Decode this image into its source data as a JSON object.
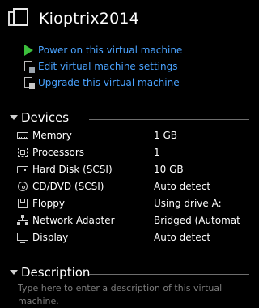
{
  "vm": {
    "name": "Kioptrix2014"
  },
  "actions": [
    {
      "label": "Power on this virtual machine",
      "icon": "power-on-icon"
    },
    {
      "label": "Edit virtual machine settings",
      "icon": "edit-settings-icon"
    },
    {
      "label": "Upgrade this virtual machine",
      "icon": "upgrade-icon"
    }
  ],
  "devices": {
    "title": "Devices",
    "rows": [
      {
        "name": "Memory",
        "value": "1 GB",
        "icon": "memory-icon"
      },
      {
        "name": "Processors",
        "value": "1",
        "icon": "processor-icon"
      },
      {
        "name": "Hard Disk (SCSI)",
        "value": "10 GB",
        "icon": "hard-disk-icon"
      },
      {
        "name": "CD/DVD (SCSI)",
        "value": "Auto detect",
        "icon": "cd-dvd-icon"
      },
      {
        "name": "Floppy",
        "value": "Using drive A:",
        "icon": "floppy-icon"
      },
      {
        "name": "Network Adapter",
        "value": "Bridged (Automat...",
        "icon": "network-adapter-icon"
      },
      {
        "name": "Display",
        "value": "Auto detect",
        "icon": "display-icon"
      }
    ]
  },
  "description": {
    "title": "Description",
    "placeholder": "Type here to enter a description of this virtual machine."
  },
  "colors": {
    "background": "#000000",
    "link": "#4aa3ff",
    "play": "#3cbf3c",
    "placeholder": "#7d7d7d"
  }
}
